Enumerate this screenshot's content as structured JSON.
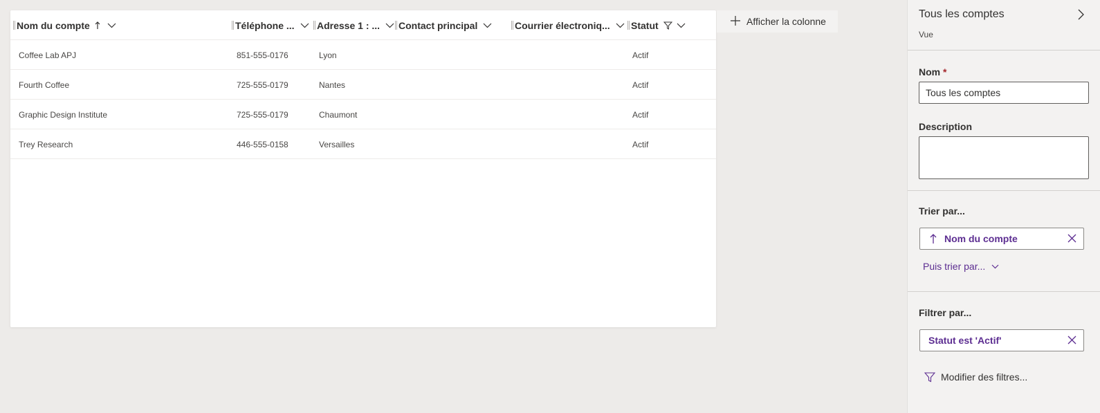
{
  "grid": {
    "columns": [
      {
        "label": "Nom du compte",
        "sort_icon": "arrow-up-icon"
      },
      {
        "label": "Téléphone ..."
      },
      {
        "label": "Adresse 1 : ..."
      },
      {
        "label": "Contact principal"
      },
      {
        "label": "Courrier électroniq..."
      },
      {
        "label": "Statut",
        "filter_icon": "filter-icon"
      }
    ],
    "rows": [
      {
        "name": "Coffee Lab APJ",
        "phone": "851-555-0176",
        "city": "Lyon",
        "contact": "",
        "email": "",
        "status": "Actif"
      },
      {
        "name": "Fourth Coffee",
        "phone": "725-555-0179",
        "city": "Nantes",
        "contact": "",
        "email": "",
        "status": "Actif"
      },
      {
        "name": "Graphic Design Institute",
        "phone": "725-555-0179",
        "city": "Chaumont",
        "contact": "",
        "email": "",
        "status": "Actif"
      },
      {
        "name": "Trey Research",
        "phone": "446-555-0158",
        "city": "Versailles",
        "contact": "",
        "email": "",
        "status": "Actif"
      }
    ],
    "add_column_label": "Afficher la colonne"
  },
  "panel": {
    "title": "Tous les comptes",
    "subtitle": "Vue",
    "name_label": "Nom",
    "name_required": "*",
    "name_value": "Tous les comptes",
    "description_label": "Description",
    "description_value": "",
    "sort_label": "Trier par...",
    "sort_chip": "Nom du compte",
    "then_sort_label": "Puis trier par...",
    "filter_label": "Filtrer par...",
    "filter_chip": "Statut est 'Actif'",
    "edit_filters_label": "Modifier des filtres..."
  },
  "colors": {
    "accent": "#5c2d91",
    "background": "#edebe9",
    "panel_background": "#f3f2f1",
    "required": "#a4262c"
  }
}
